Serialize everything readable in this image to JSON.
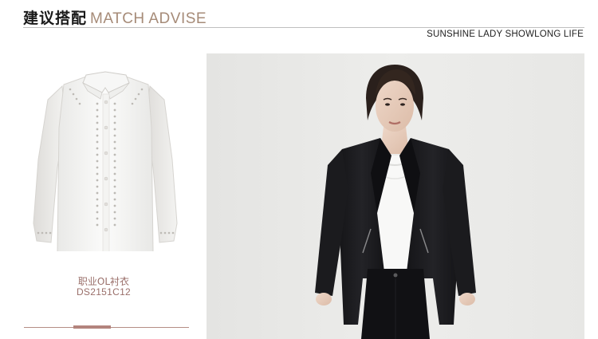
{
  "header": {
    "title_cn": "建议搭配",
    "title_en": "MATCH ADVISE",
    "tagline": "SUNSHINE LADY SHOWLONG LIFE"
  },
  "product": {
    "name": "职业OL衬衣",
    "code": "DS2151C12",
    "image_icon": "white-blouse-image"
  },
  "model": {
    "image_icon": "model-photo"
  },
  "slider": {
    "position": 0.39
  },
  "colors": {
    "accent": "#a68b78",
    "caption": "#9a6f6a",
    "slider": "#b3847d",
    "rule": "#bfbfbf"
  }
}
